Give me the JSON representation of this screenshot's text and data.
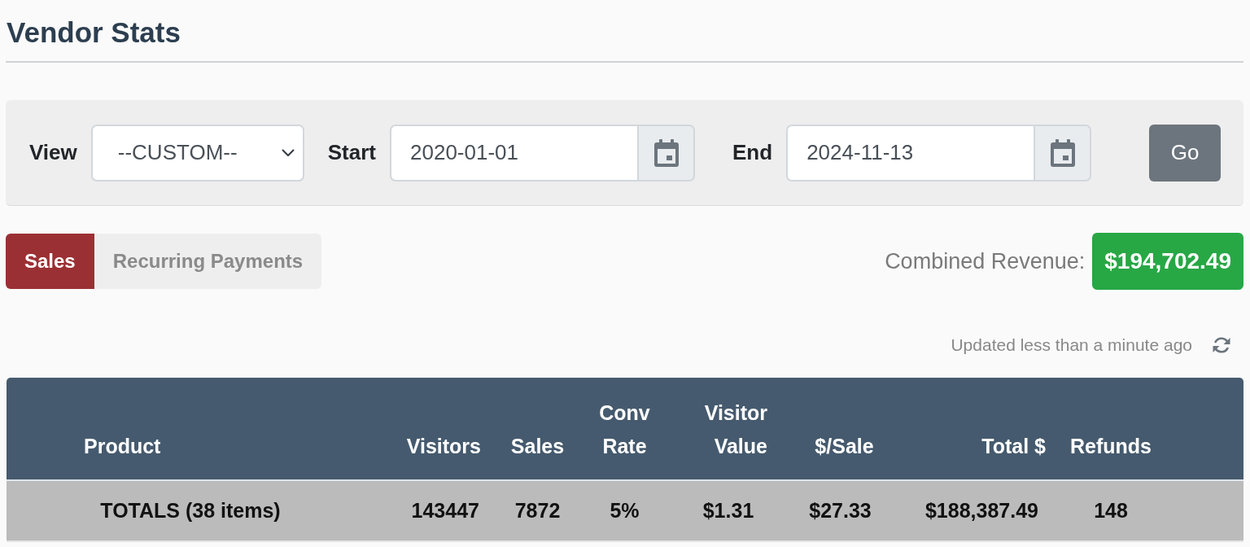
{
  "page": {
    "title": "Vendor Stats"
  },
  "filters": {
    "fields": [
      {
        "kind": "select",
        "label": "View",
        "value": "--CUSTOM--"
      },
      {
        "kind": "date",
        "label": "Start",
        "value": "2020-01-01"
      },
      {
        "kind": "date",
        "label": "End",
        "value": "2024-11-13"
      }
    ],
    "submit": "Go"
  },
  "tabs": [
    {
      "label": "Sales",
      "selected": true
    },
    {
      "label": "Recurring Payments",
      "selected": false
    }
  ],
  "revenue": {
    "label": "Combined Revenue:",
    "value": "$194,702.49"
  },
  "updated": {
    "text": "Updated less than a minute ago"
  },
  "table": {
    "columns": [
      "Product",
      "Visitors",
      "Sales",
      "Conv Rate",
      "Visitor Value",
      "$/Sale",
      "Total $",
      "Refunds"
    ],
    "rows": [
      {
        "kind": "totals",
        "cells": [
          "TOTALS (38 items)",
          "143447",
          "7872",
          "5%",
          "$1.31",
          "$27.33",
          "$188,387.49",
          "148"
        ]
      }
    ]
  }
}
